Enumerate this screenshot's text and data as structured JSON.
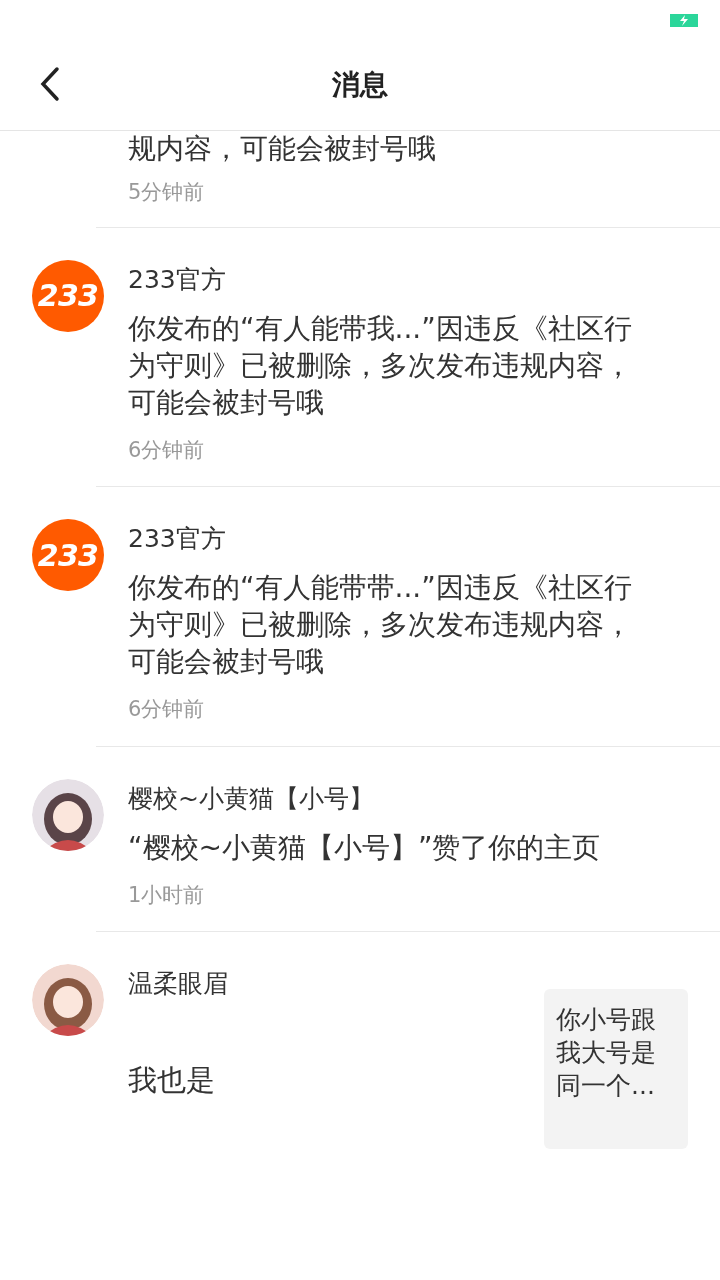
{
  "status_bar": {
    "battery_charging": true
  },
  "header": {
    "title": "消息"
  },
  "messages": [
    {
      "kind": "partial",
      "text": "规内容，可能会被封号哦",
      "time": "5分钟前"
    },
    {
      "kind": "notice",
      "avatar_text": "233",
      "sender": "233官方",
      "text": "你发布的“有人能带我...”因违反《社区行为守则》已被删除，多次发布违规内容，可能会被封号哦",
      "time": "6分钟前"
    },
    {
      "kind": "notice",
      "avatar_text": "233",
      "sender": "233官方",
      "text": "你发布的“有人能带带...”因违反《社区行为守则》已被删除，多次发布违规内容，可能会被封号哦",
      "time": "6分钟前"
    },
    {
      "kind": "like",
      "sender": "樱校~小黄猫【小号】",
      "text": "“樱校~小黄猫【小号】”赞了你的主页",
      "time": "1小时前"
    },
    {
      "kind": "reply",
      "sender": "温柔眼眉",
      "text": "我也是",
      "quote": "你小号跟我大号是同一个..."
    }
  ]
}
